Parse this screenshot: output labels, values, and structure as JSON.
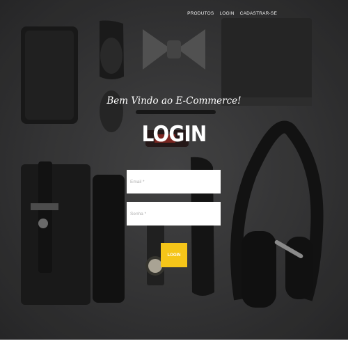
{
  "nav": {
    "items": [
      {
        "label": "PRODUTOS"
      },
      {
        "label": "LOGIN"
      },
      {
        "label": "CADASTRAR-SE"
      }
    ]
  },
  "hero": {
    "welcome": "Bem Vindo ao E-Commerce!",
    "title": "LOGIN"
  },
  "form": {
    "email_placeholder": "Email *",
    "password_placeholder": "Senha *",
    "submit_label": "LOGIN"
  },
  "colors": {
    "background": "#3a3a3b",
    "button": "#f5c519",
    "text": "#ffffff"
  }
}
